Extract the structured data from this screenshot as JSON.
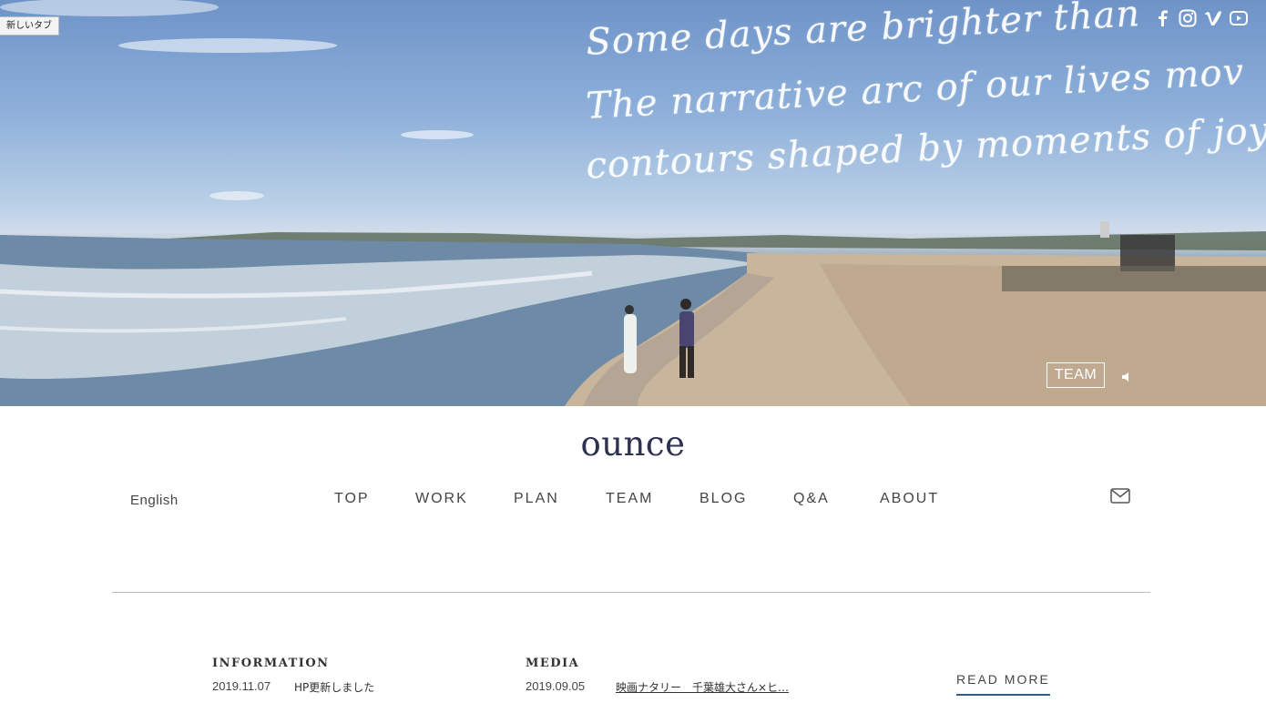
{
  "browser": {
    "tab_label": "新しいタブ"
  },
  "hero": {
    "script_lines": [
      "Some days are brighter than",
      "The narrative arc of our lives mov",
      "contours shaped by moments of joy"
    ],
    "social_icons": [
      "facebook-icon",
      "instagram-icon",
      "vimeo-icon",
      "youtube-icon"
    ],
    "overlay_label": "TEAM",
    "mute_icon": "speaker-mute-icon"
  },
  "header": {
    "logo": "ounce",
    "language": "English",
    "nav": [
      "TOP",
      "WORK",
      "PLAN",
      "TEAM",
      "BLOG",
      "Q&A",
      "ABOUT"
    ],
    "contact_icon": "mail-icon"
  },
  "news": {
    "information": {
      "title": "INFORMATION",
      "date": "2019.11.07",
      "text": "HP更新しました"
    },
    "media": {
      "title": "MEDIA",
      "date": "2019.09.05",
      "text": "映画ナタリー　千葉雄大さん×ヒ…"
    },
    "read_more": "READ MORE"
  },
  "colors": {
    "logo": "#2f3150",
    "accent": "#2f5f8a"
  }
}
